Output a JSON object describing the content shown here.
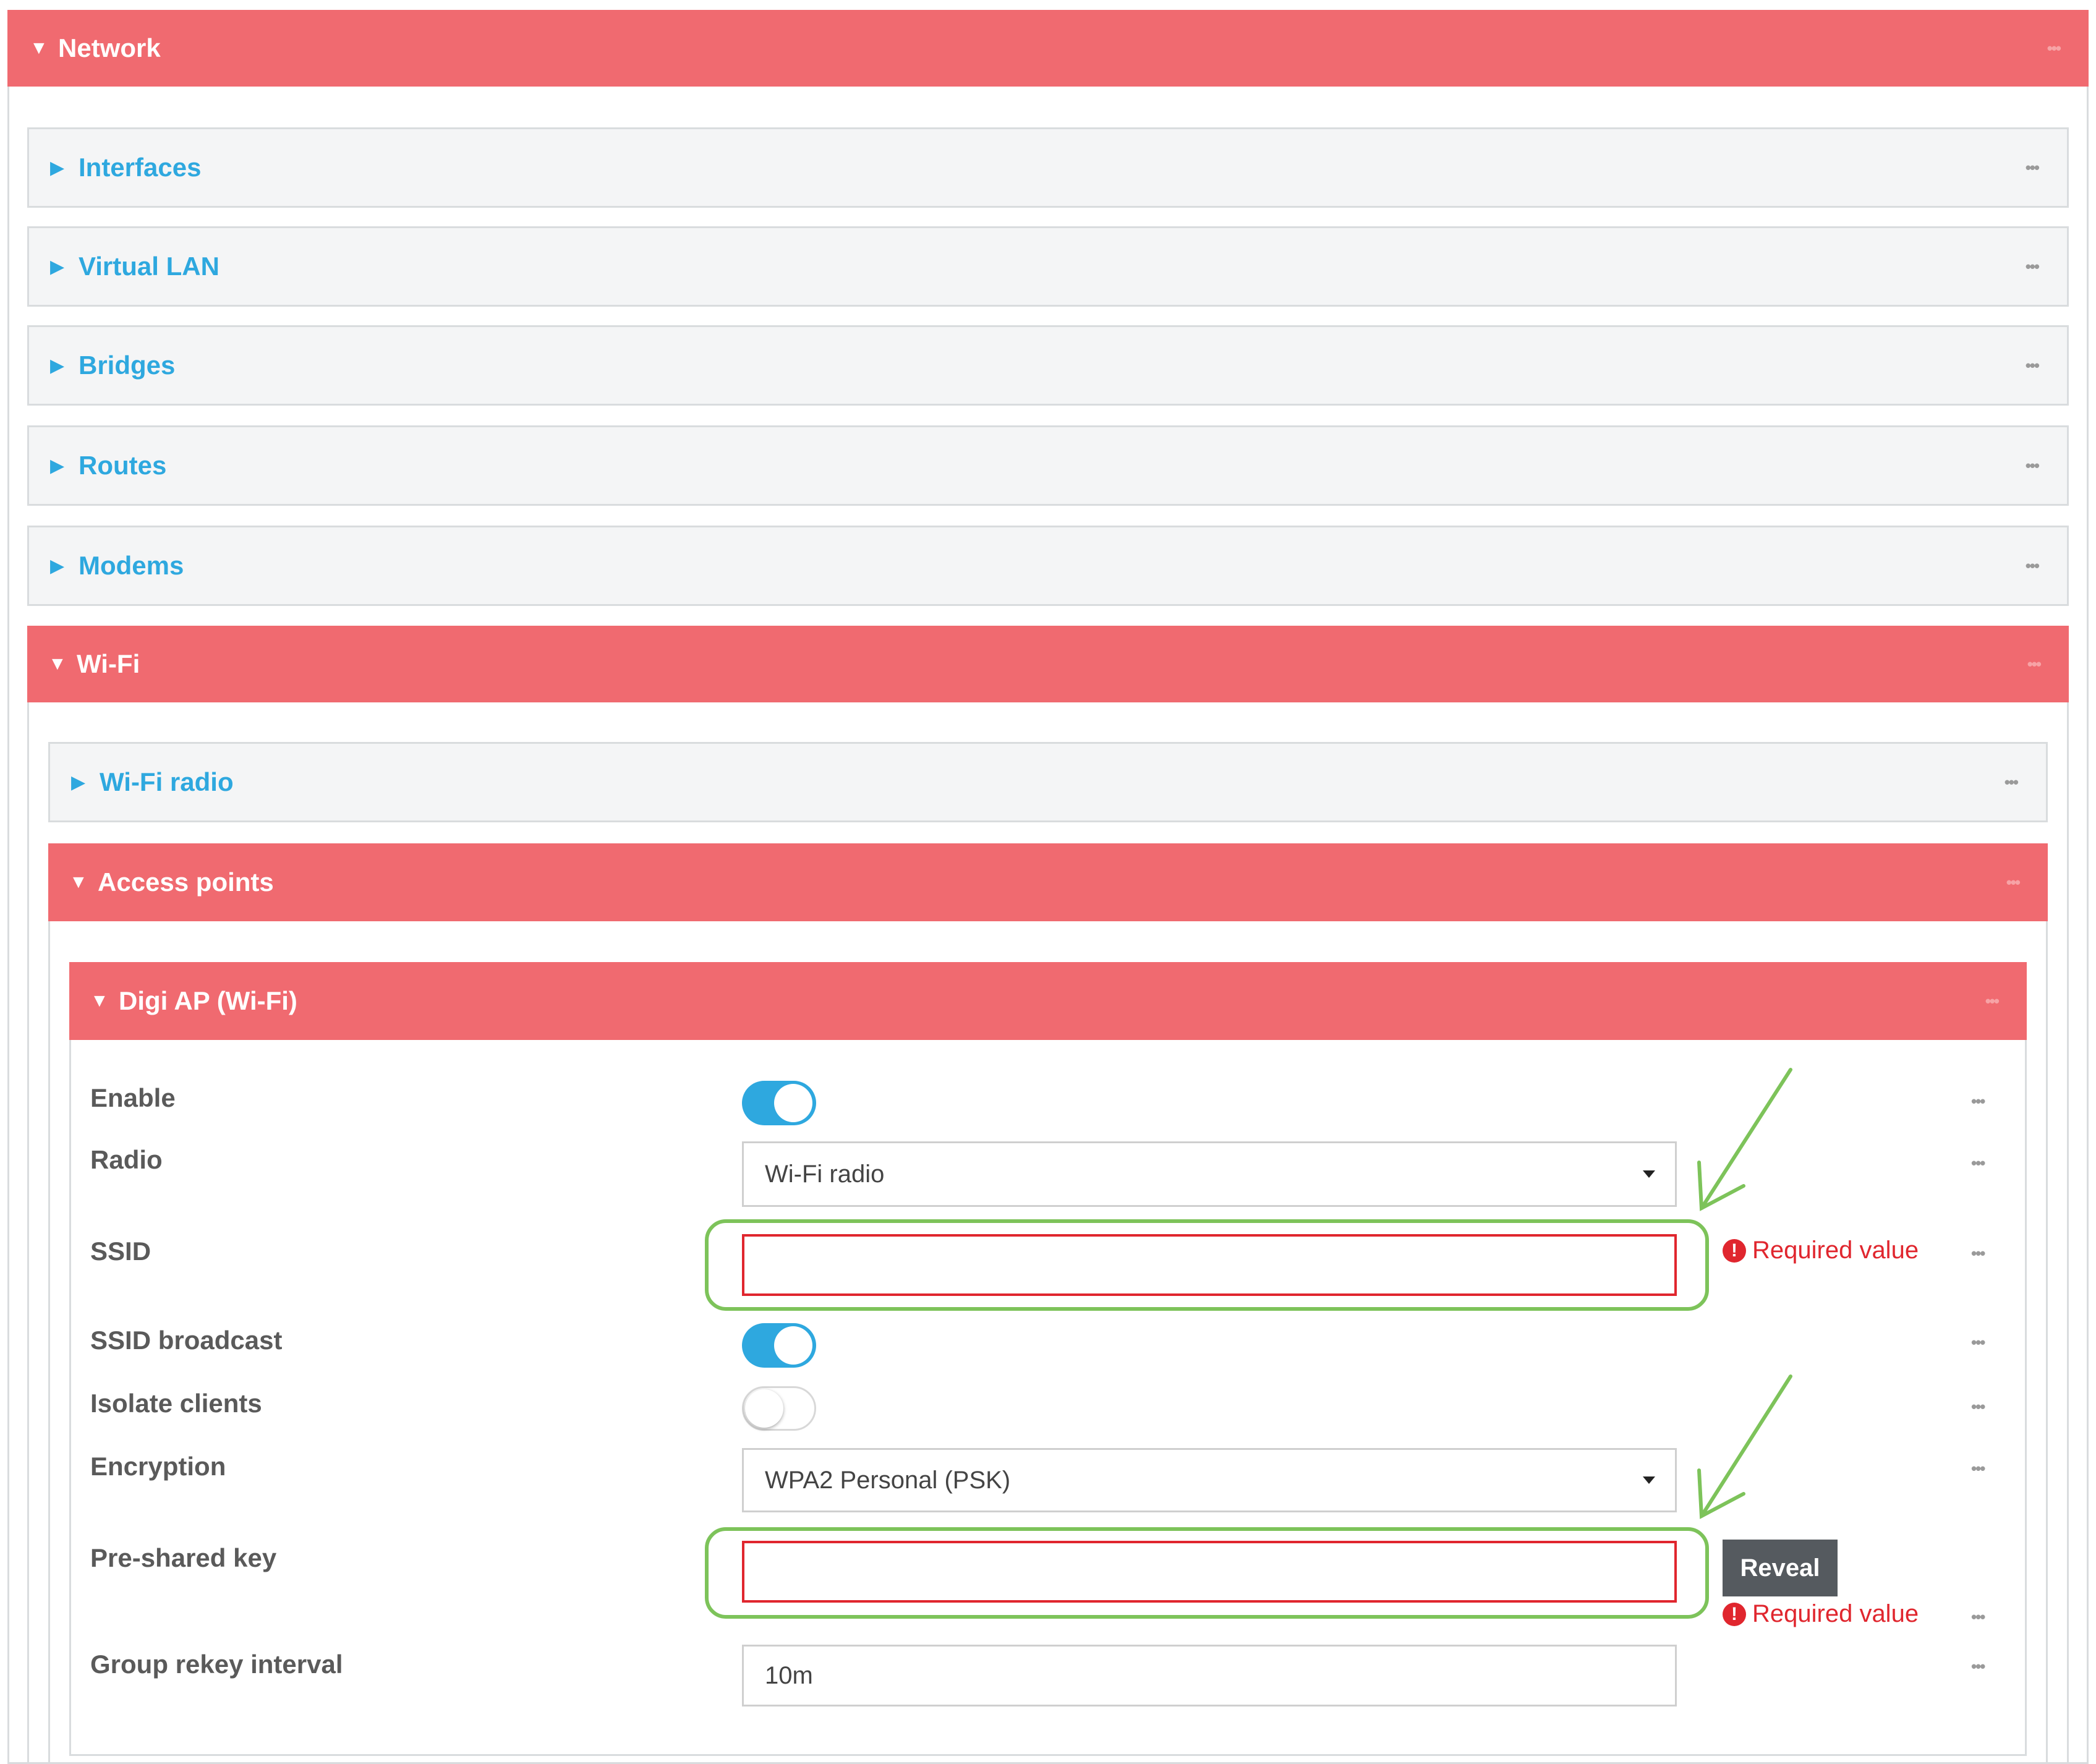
{
  "panels": {
    "network": "Network",
    "interfaces": "Interfaces",
    "virtual_lan": "Virtual LAN",
    "bridges": "Bridges",
    "routes": "Routes",
    "modems": "Modems",
    "wifi": "Wi-Fi",
    "wifi_radio": "Wi-Fi radio",
    "access_points": "Access points",
    "digi_ap": "Digi AP (Wi-Fi)"
  },
  "form": {
    "enable": {
      "label": "Enable",
      "value": true
    },
    "radio": {
      "label": "Radio",
      "value": "Wi-Fi radio"
    },
    "ssid": {
      "label": "SSID",
      "value": "",
      "error": "Required value"
    },
    "ssid_broadcast": {
      "label": "SSID broadcast",
      "value": true
    },
    "isolate_clients": {
      "label": "Isolate clients",
      "value": false
    },
    "encryption": {
      "label": "Encryption",
      "value": "WPA2 Personal (PSK)"
    },
    "psk": {
      "label": "Pre-shared key",
      "value": "",
      "reveal": "Reveal",
      "error": "Required value"
    },
    "group_rekey": {
      "label": "Group rekey interval",
      "value": "10m"
    }
  },
  "icons": {
    "expanded": "triangle-down-icon",
    "collapsed": "triangle-right-icon",
    "menu": "ellipsis-icon",
    "error": "exclamation-circle-icon"
  },
  "colors": {
    "expanded_header": "#f06a70",
    "link": "#2ea8df",
    "error": "#e0262e",
    "annotation": "#7dc35a",
    "toggle_on": "#2ea8df"
  }
}
